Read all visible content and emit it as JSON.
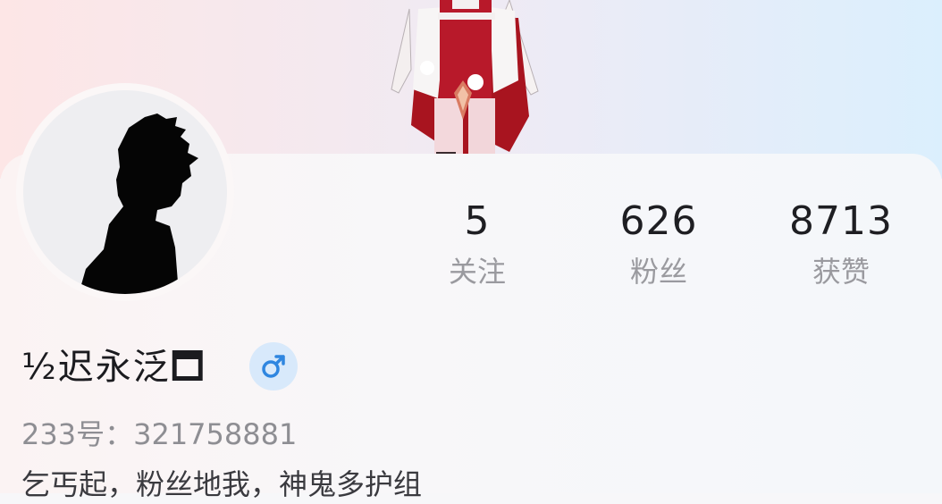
{
  "profile": {
    "name": "½迟永泛🗖",
    "id_label": "233号：",
    "id_value": "321758881",
    "bio": "乞丐起，粉丝地我，神鬼多护组"
  },
  "stats": {
    "following": {
      "value": "5",
      "label": "关注"
    },
    "followers": {
      "value": "626",
      "label": "粉丝"
    },
    "likes": {
      "value": "8713",
      "label": "获赞"
    }
  },
  "gender": {
    "icon": "male-icon",
    "color": "#2f86e0"
  },
  "colors": {
    "banner_left": "#fde6e6",
    "banner_right": "#dbeffd",
    "text_primary": "#1e1e22",
    "text_secondary": "#9a9a9f"
  }
}
